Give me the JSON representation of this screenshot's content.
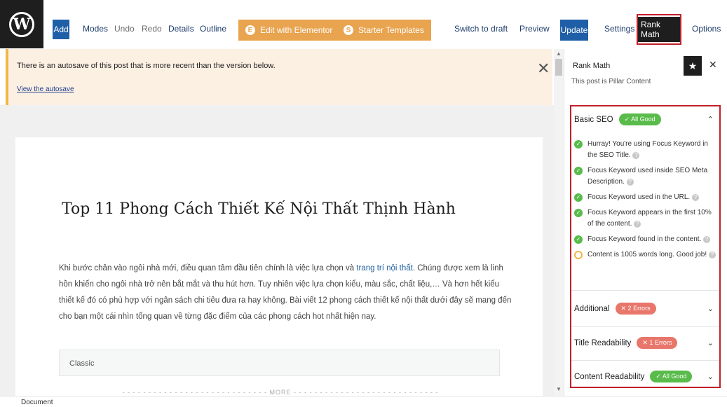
{
  "toolbar": {
    "add": "Add",
    "modes": "Modes",
    "undo": "Undo",
    "redo": "Redo",
    "details": "Details",
    "outline": "Outline",
    "elementor": "Edit with Elementor",
    "starter": "Starter Templates",
    "switch_draft": "Switch to draft",
    "preview": "Preview",
    "update": "Update",
    "settings": "Settings",
    "rank_math": "Rank Math",
    "options": "Options"
  },
  "notice": {
    "text": "There is an autosave of this post that is more recent than the version below.",
    "link": "View the autosave",
    "close": "✕"
  },
  "post": {
    "title": "Top 11 Phong Cách Thiết Kế Nội Thất Thịnh Hành",
    "para_before": "Khi bước chân vào ngôi nhà mới, điều quan tâm đầu tiên chính là việc lựa chọn và ",
    "para_link": "trang trí nội thất",
    "para_after": ". Chúng được xem là linh hồn khiến cho ngôi nhà trở nên bắt mắt và thu hút hơn. Tuy nhiên việc lựa chọn kiểu, màu sắc, chất liệu,… Và hơn hết kiểu thiết kế đó có phù hợp với ngân sách chi tiêu đưa ra hay không. Bài viết 12 phong cách thiết kế nội thất dưới đây sẽ mang đến cho bạn một cái nhìn tổng quan về từng đặc điểm của các phong cách hot nhất hiện nay.",
    "classic_block": "Classic",
    "more": "MORE"
  },
  "sidebar": {
    "title": "Rank Math",
    "cut_text": "This post is Pillar Content",
    "basic_seo": {
      "label": "Basic SEO",
      "badge": "✓ All Good",
      "checks": [
        "Hurray! You're using Focus Keyword in the SEO Title.",
        "Focus Keyword used inside SEO Meta Description.",
        "Focus Keyword used in the URL.",
        "Focus Keyword appears in the first 10% of the content.",
        "Focus Keyword found in the content.",
        "Content is 1005 words long. Good job!"
      ]
    },
    "additional": {
      "label": "Additional",
      "badge": "✕ 2 Errors"
    },
    "title_readability": {
      "label": "Title Readability",
      "badge": "✕ 1 Errors"
    },
    "content_readability": {
      "label": "Content Readability",
      "badge": "✓ All Good"
    }
  },
  "footer": {
    "label": "Document"
  },
  "colors": {
    "accent_blue": "#1f5fa8",
    "elementor_orange": "#e9a44f",
    "highlight_red": "#c0202a",
    "good_green": "#58bb4a",
    "error_red": "#e8766b",
    "notice_bg": "#fcf0e3"
  }
}
